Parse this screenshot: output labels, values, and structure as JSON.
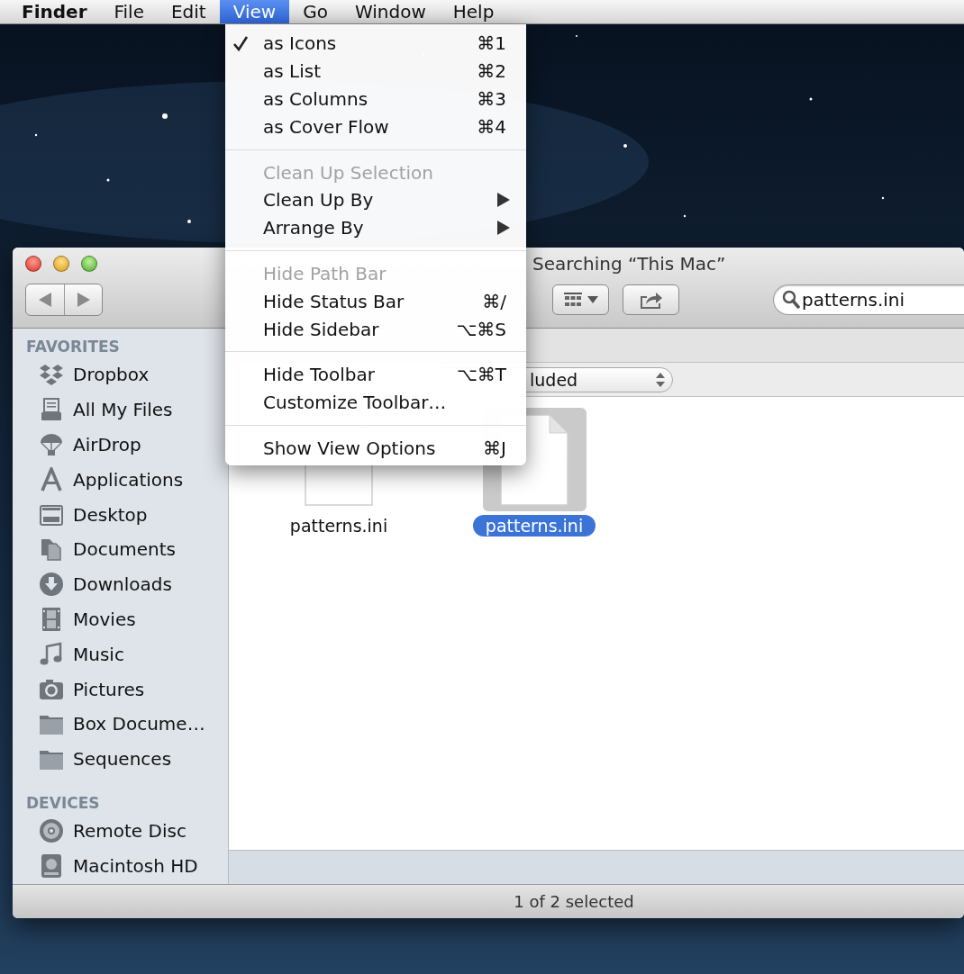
{
  "menu_bar": {
    "items": [
      {
        "kind": "app",
        "label": "Finder",
        "selected": false
      },
      {
        "kind": "menu",
        "label": "File",
        "selected": false
      },
      {
        "kind": "menu",
        "label": "Edit",
        "selected": false
      },
      {
        "kind": "menu",
        "label": "View",
        "selected": true
      },
      {
        "kind": "menu",
        "label": "Go",
        "selected": false
      },
      {
        "kind": "menu",
        "label": "Window",
        "selected": false
      },
      {
        "kind": "menu",
        "label": "Help",
        "selected": false
      }
    ]
  },
  "view_menu": {
    "items": [
      {
        "kind": "item",
        "label": "as Icons",
        "shortcut": "⌘1",
        "checked": true,
        "disabled": false,
        "submenu": false
      },
      {
        "kind": "item",
        "label": "as List",
        "shortcut": "⌘2",
        "checked": false,
        "disabled": false,
        "submenu": false
      },
      {
        "kind": "item",
        "label": "as Columns",
        "shortcut": "⌘3",
        "checked": false,
        "disabled": false,
        "submenu": false
      },
      {
        "kind": "item",
        "label": "as Cover Flow",
        "shortcut": "⌘4",
        "checked": false,
        "disabled": false,
        "submenu": false
      },
      {
        "kind": "separator"
      },
      {
        "kind": "item",
        "label": "Clean Up Selection",
        "checked": false,
        "disabled": true,
        "submenu": false
      },
      {
        "kind": "item",
        "label": "Clean Up By",
        "checked": false,
        "disabled": false,
        "submenu": true
      },
      {
        "kind": "item",
        "label": "Arrange By",
        "checked": false,
        "disabled": false,
        "submenu": true
      },
      {
        "kind": "separator"
      },
      {
        "kind": "item",
        "label": "Hide Path Bar",
        "checked": false,
        "disabled": true,
        "submenu": false
      },
      {
        "kind": "item",
        "label": "Hide Status Bar",
        "shortcut": "⌘/",
        "checked": false,
        "disabled": false,
        "submenu": false
      },
      {
        "kind": "item",
        "label": "Hide Sidebar",
        "shortcut": "⌥⌘S",
        "checked": false,
        "disabled": false,
        "submenu": false
      },
      {
        "kind": "separator"
      },
      {
        "kind": "item",
        "label": "Hide Toolbar",
        "shortcut": "⌥⌘T",
        "checked": false,
        "disabled": false,
        "submenu": false
      },
      {
        "kind": "item",
        "label": "Customize Toolbar…",
        "checked": false,
        "disabled": false,
        "submenu": false
      },
      {
        "kind": "separator"
      },
      {
        "kind": "item",
        "label": "Show View Options",
        "shortcut": "⌘J",
        "checked": false,
        "disabled": false,
        "submenu": false
      }
    ]
  },
  "finder_window": {
    "title": "Searching “This Mac”",
    "search_field": {
      "value": "patterns.ini"
    },
    "filter_popup": {
      "value": "luded"
    },
    "sidebar": {
      "sections": [
        {
          "heading": "FAVORITES",
          "items": [
            "Dropbox",
            "All My Files",
            "AirDrop",
            "Applications",
            "Desktop",
            "Documents",
            "Downloads",
            "Movies",
            "Music",
            "Pictures",
            "Box Docume…",
            "Sequences"
          ]
        },
        {
          "heading": "DEVICES",
          "items": [
            "Remote Disc",
            "Macintosh HD"
          ]
        }
      ]
    },
    "files": [
      {
        "name": "patterns.ini",
        "selected": false
      },
      {
        "name": "patterns.ini",
        "selected": true
      }
    ],
    "status_bar": "1 of 2 selected"
  }
}
